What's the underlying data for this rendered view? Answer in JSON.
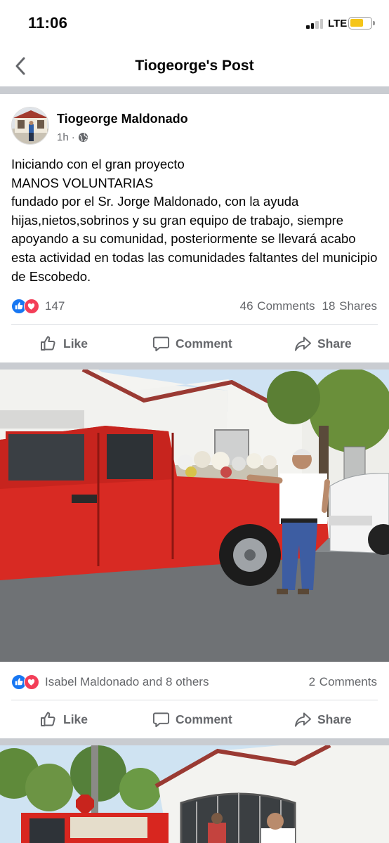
{
  "status_bar": {
    "time": "11:06",
    "network": "LTE"
  },
  "nav": {
    "title": "Tiogeorge's Post"
  },
  "post": {
    "author": "Tiogeorge Maldonado",
    "time": "1h",
    "text": "Iniciando con el gran proyecto\nMANOS VOLUNTARIAS\nfundado por el Sr. Jorge Maldonado, con la ayuda hijas,nietos,sobrinos y su gran equipo de trabajo, siempre apoyando a su comunidad, posteriormente se llevará  acabo esta actividad en todas las comunidades faltantes del municipio de Escobedo.",
    "reactions_count": "147",
    "comments": "46 Comments",
    "shares": "18 Shares",
    "actions": {
      "like": "Like",
      "comment": "Comment",
      "share": "Share"
    }
  },
  "photo1": {
    "reactions_text": "Isabel Maldonado and 8 others",
    "comments": "2 Comments",
    "actions": {
      "like": "Like",
      "comment": "Comment",
      "share": "Share"
    }
  },
  "colors": {
    "like_blue": "#1877f2",
    "love_red": "#f33e58",
    "secondary_text": "#65676b",
    "separator": "#c9ccd1"
  }
}
